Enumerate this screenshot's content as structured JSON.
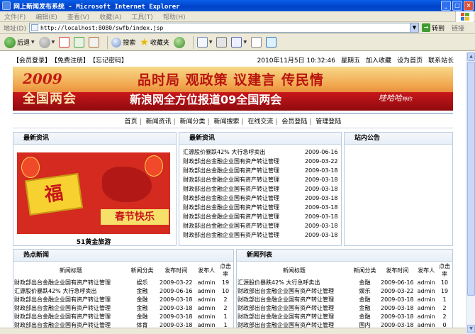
{
  "window": {
    "title": "网上新闻发布系统 - Microsoft Internet Explorer"
  },
  "menu": [
    "文件(F)",
    "编辑(E)",
    "查看(V)",
    "收藏(A)",
    "工具(T)",
    "帮助(H)"
  ],
  "address": {
    "label": "地址(D)",
    "url": "http://localhost:8080/swfb/index.jsp",
    "go": "转到",
    "links": "链接"
  },
  "toolbar": {
    "back": "后退",
    "search": "搜索",
    "favorites": "收藏夹"
  },
  "topinfo": {
    "login": "【会员登录】",
    "register": "【免费注册】",
    "forgot": "【忘记密码】",
    "datetime": "2010年11月5日 10:32:46",
    "weekday": "星期五",
    "bookmark": "加入收藏",
    "homepage": "设为首页",
    "contact": "联系站长"
  },
  "banner": {
    "year": "2009",
    "subtitle": "全国两会",
    "slogan": "品时局 观政策 议建言 传民情",
    "report": "新浪网全方位报道09全国两会",
    "sign": "哇哈哈",
    "sign_note": "特约"
  },
  "nav": [
    "首页",
    "新闻资讯",
    "新闻分类",
    "新闻搜索",
    "在线交流",
    "会员登陆",
    "管理登陆"
  ],
  "latest_left": {
    "title": "最新资讯",
    "image_text": {
      "fu": "福",
      "spring": "春节快乐"
    },
    "caption": "51黄金旅游"
  },
  "latest_right": {
    "title": "最新资讯",
    "items": [
      {
        "title": "汇源股价暴跌42% 大行急呼卖出",
        "date": "2009-06-16"
      },
      {
        "title": "财政部出台金融企业国有资产转让管理",
        "date": "2009-03-22"
      },
      {
        "title": "财政部出台金融企业国有资产转让管理",
        "date": "2009-03-18"
      },
      {
        "title": "财政部出台金融企业国有资产转让管理",
        "date": "2009-03-18"
      },
      {
        "title": "财政部出台金融企业国有资产转让管理",
        "date": "2009-03-18"
      },
      {
        "title": "财政部出台金融企业国有资产转让管理",
        "date": "2009-03-18"
      },
      {
        "title": "财政部出台金融企业国有资产转让管理",
        "date": "2009-03-18"
      },
      {
        "title": "财政部出台金融企业国有资产转让管理",
        "date": "2009-03-18"
      },
      {
        "title": "财政部出台金融企业国有资产转让管理",
        "date": "2009-03-18"
      },
      {
        "title": "财政部出台金融企业国有资产转让管理",
        "date": "2009-03-18"
      }
    ]
  },
  "notice": {
    "title": "站内公告"
  },
  "hot": {
    "title": "热点新闻",
    "columns": [
      "新闻标题",
      "新闻分类",
      "发布时间",
      "发布人",
      "点击率"
    ],
    "rows": [
      [
        "财政部出台金融企业国有资产转让管理",
        "娱乐",
        "2009-03-22",
        "admin",
        "19"
      ],
      [
        "汇源股价暴跌42% 大行急呼卖出",
        "金融",
        "2009-06-16",
        "admin",
        "10"
      ],
      [
        "财政部出台金融企业国有资产转让管理",
        "金融",
        "2009-03-18",
        "admin",
        "2"
      ],
      [
        "财政部出台金融企业国有资产转让管理",
        "金融",
        "2009-03-18",
        "admin",
        "2"
      ],
      [
        "财政部出台金融企业国有资产转让管理",
        "金融",
        "2009-03-18",
        "admin",
        "1"
      ],
      [
        "财政部出台金融企业国有资产转让管理",
        "体育",
        "2009-03-18",
        "admin",
        "1"
      ]
    ]
  },
  "newslist": {
    "title": "新闻列表",
    "columns": [
      "新闻标题",
      "新闻分类",
      "发布时间",
      "发布人",
      "点击率"
    ],
    "rows": [
      [
        "汇源股价暴跌42% 大行急呼卖出",
        "金融",
        "2009-06-16",
        "admin",
        "10"
      ],
      [
        "财政部出台金融企业国有资产转让管理",
        "娱乐",
        "2009-03-22",
        "admin",
        "19"
      ],
      [
        "财政部出台金融企业国有资产转让管理",
        "金融",
        "2009-03-18",
        "admin",
        "1"
      ],
      [
        "财政部出台金融企业国有资产转让管理",
        "金融",
        "2009-03-18",
        "admin",
        "2"
      ],
      [
        "财政部出台金融企业国有资产转让管理",
        "金融",
        "2009-03-18",
        "admin",
        "2"
      ],
      [
        "财政部出台金融企业国有资产转让管理",
        "国内",
        "2009-03-18",
        "admin",
        "0"
      ]
    ]
  }
}
